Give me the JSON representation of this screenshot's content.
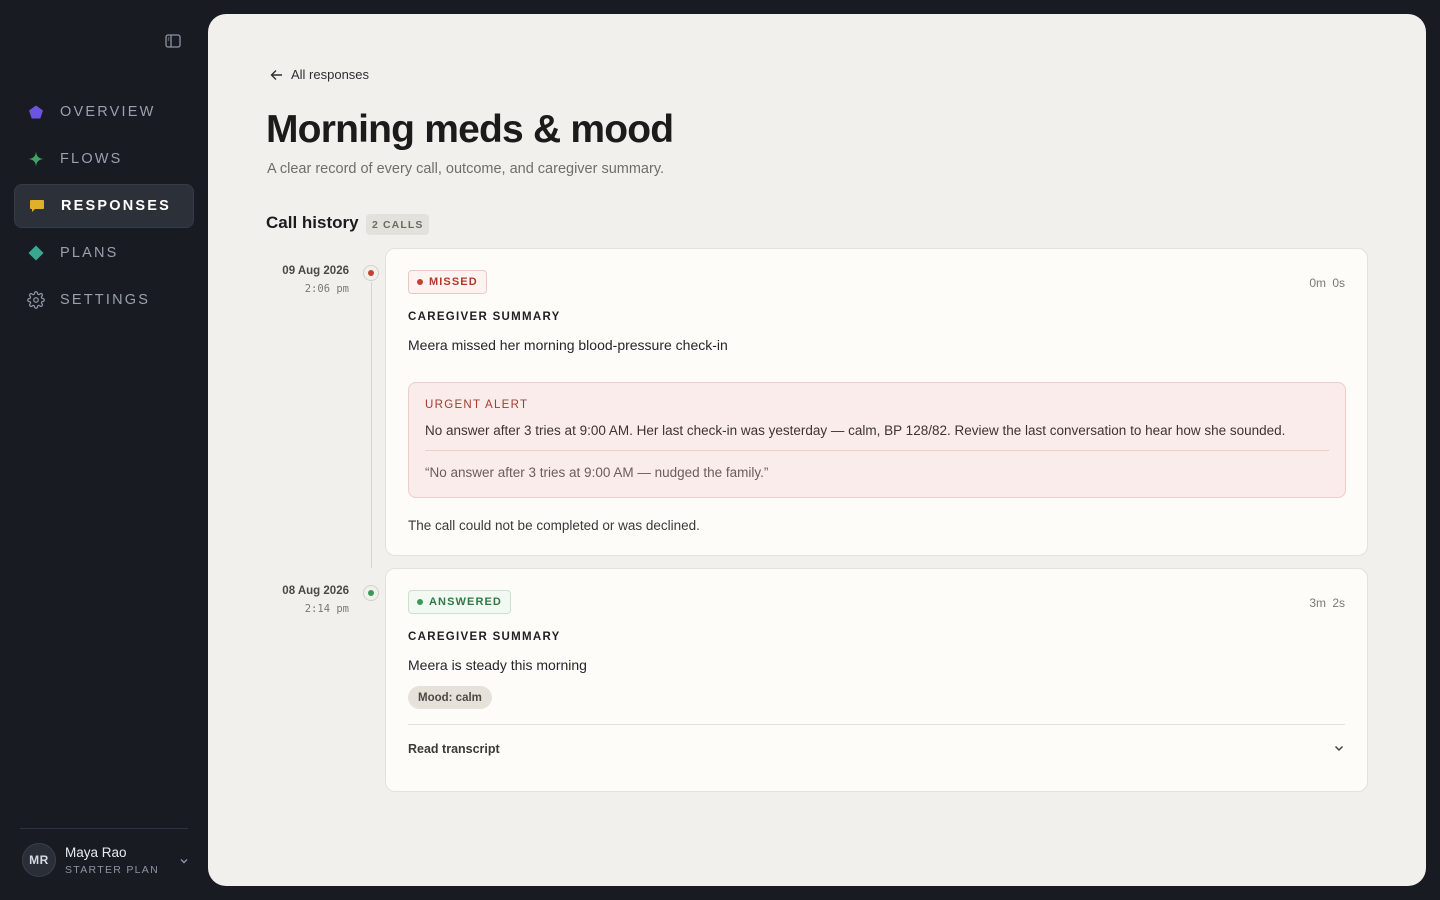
{
  "sidebar": {
    "items": [
      {
        "label": "OVERVIEW",
        "icon": "pentagon-icon",
        "color": "#6b54e0"
      },
      {
        "label": "FLOWS",
        "icon": "sparkle-icon",
        "color": "#3fa45f"
      },
      {
        "label": "RESPONSES",
        "icon": "chat-bubble-icon",
        "color": "#e0b02a",
        "active": true
      },
      {
        "label": "PLANS",
        "icon": "diamond-icon",
        "color": "#3aa88e"
      },
      {
        "label": "SETTINGS",
        "icon": "gear-icon",
        "color": "#8d94a0"
      }
    ],
    "user": {
      "initials": "MR",
      "name": "Maya Rao",
      "plan": "STARTER PLAN"
    }
  },
  "header": {
    "back_label": "All responses",
    "title": "Morning meds & mood",
    "subtitle": "A clear record of every call, outcome, and caregiver summary."
  },
  "history": {
    "title": "Call history",
    "count": "2 CALLS",
    "calls": [
      {
        "date": "09 Aug 2026",
        "time": "2:06 pm",
        "status": "MISSED",
        "duration": "0m 0s",
        "summary_label": "CAREGIVER SUMMARY",
        "summary": "Meera missed her morning blood-pressure check-in",
        "alert": {
          "title": "URGENT ALERT",
          "body": "No answer after 3 tries at 9:00 AM. Her last check-in was yesterday — calm, BP 128/82. Review the last conversation to hear how she sounded.",
          "quote": "“No answer after 3 tries at 9:00 AM — nudged the family.”"
        },
        "note": "The call could not be completed or was declined."
      },
      {
        "date": "08 Aug 2026",
        "time": "2:14 pm",
        "status": "ANSWERED",
        "duration": "3m 2s",
        "summary_label": "CAREGIVER SUMMARY",
        "summary": "Meera is steady this morning",
        "tag": "Mood: calm",
        "transcript_label": "Read transcript"
      }
    ]
  },
  "colors": {
    "missed": "#c8402f",
    "answered": "#3a9a55",
    "panel_bg": "#f1f0ed",
    "sidebar_bg": "#181c22"
  }
}
